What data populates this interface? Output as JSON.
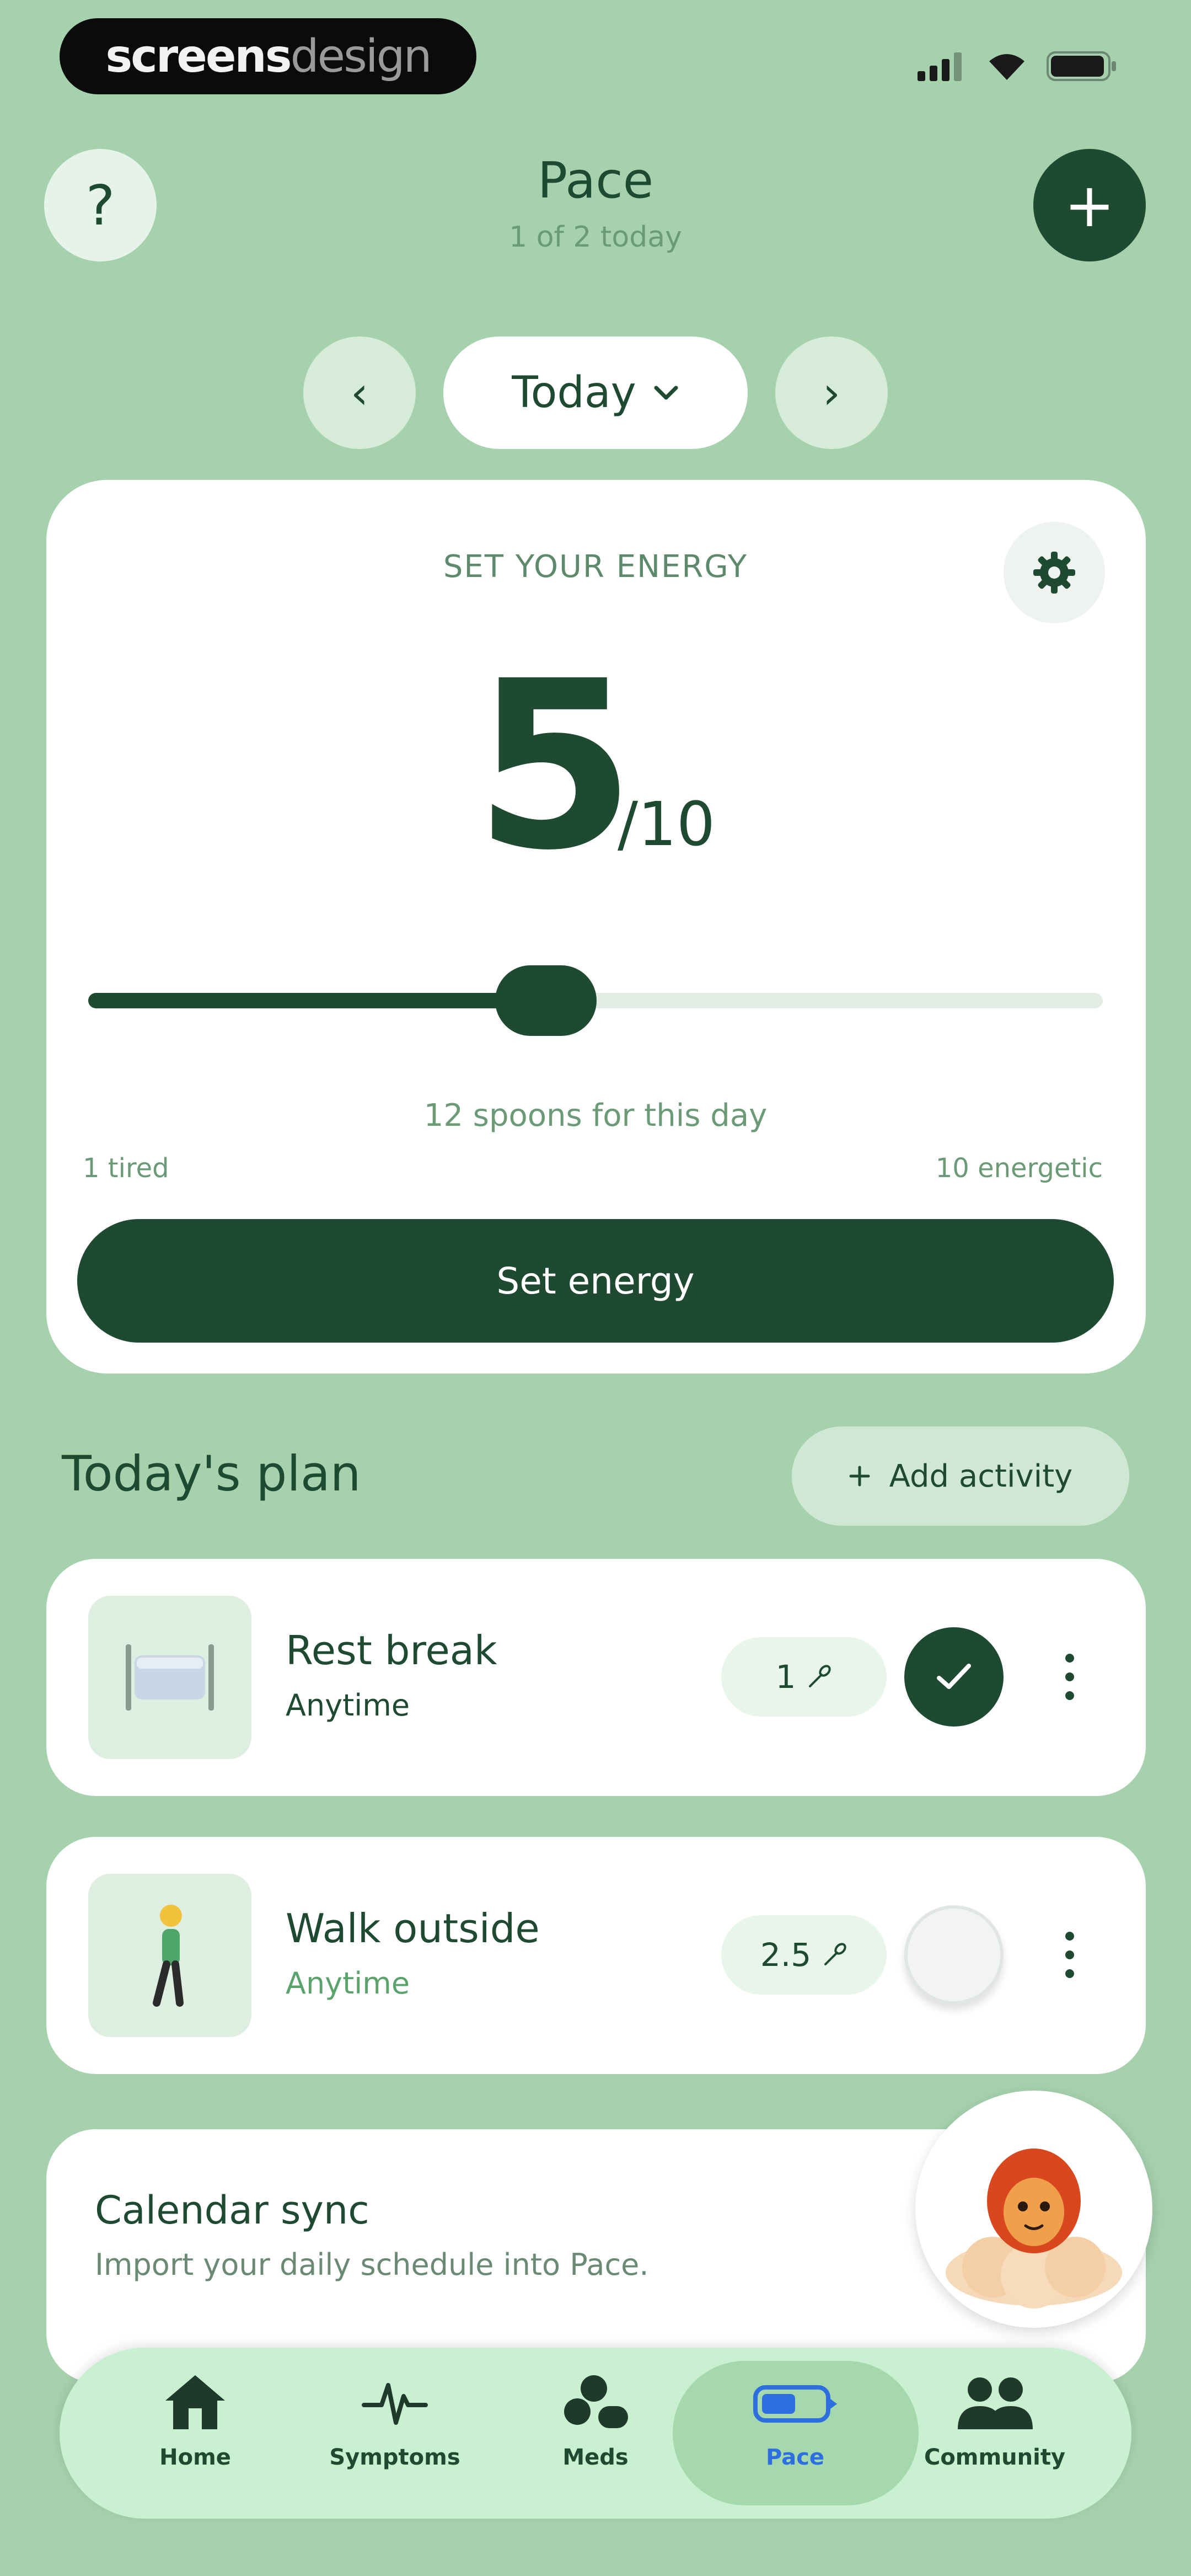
{
  "status_bar": {
    "brand_part1": "screens",
    "brand_part2": "design"
  },
  "header": {
    "title": "Pace",
    "subtitle": "1 of 2 today",
    "help_label": "?",
    "add_label": "+"
  },
  "date_nav": {
    "label": "Today",
    "prev_glyph": "‹",
    "next_glyph": "›"
  },
  "energy": {
    "section_label": "SET YOUR ENERGY",
    "value": "5",
    "max": "/10",
    "level_fraction": 0.5,
    "spoons_text": "12 spoons for this day",
    "min_label": "1 tired",
    "max_label": "10 energetic",
    "button_label": "Set energy"
  },
  "plan": {
    "title": "Today's plan",
    "add_label": "Add activity",
    "items": [
      {
        "name": "Rest break",
        "time": "Anytime",
        "spoons": "1",
        "done": true
      },
      {
        "name": "Walk outside",
        "time": "Anytime",
        "spoons": "2.5",
        "done": false
      }
    ]
  },
  "calendar": {
    "title": "Calendar sync",
    "subtitle": "Import your daily schedule into Pace."
  },
  "bottom_nav": {
    "items": [
      {
        "label": "Home",
        "icon": "home-icon"
      },
      {
        "label": "Symptoms",
        "icon": "heartbeat-icon"
      },
      {
        "label": "Meds",
        "icon": "pills-icon"
      },
      {
        "label": "Pace",
        "icon": "battery-icon"
      },
      {
        "label": "Community",
        "icon": "people-icon"
      }
    ],
    "active": "Pace"
  },
  "colors": {
    "background": "#a5d1ad",
    "primary": "#1f4a32",
    "active_nav": "#2d6fe0",
    "card": "#ffffff"
  }
}
